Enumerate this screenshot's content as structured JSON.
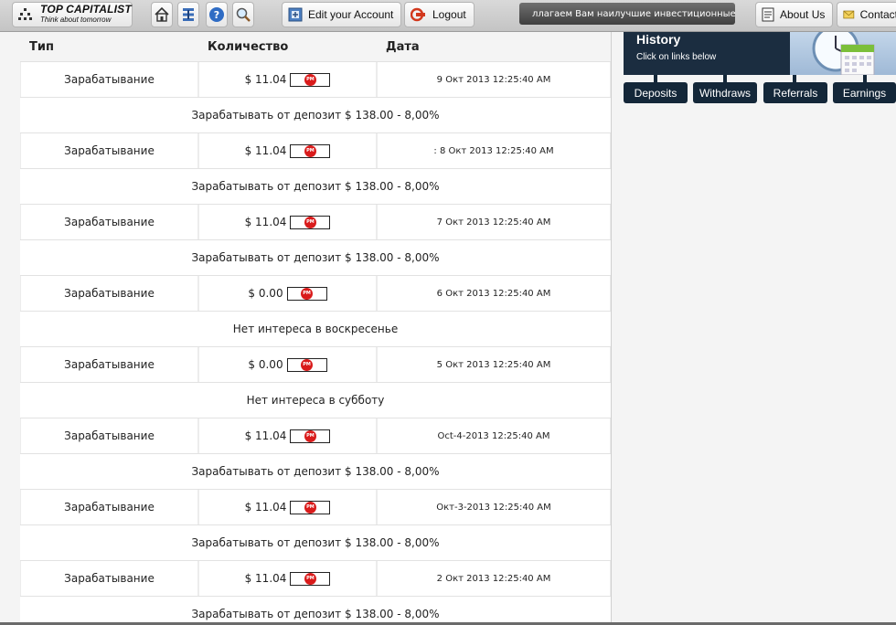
{
  "toolbar": {
    "logo_title": "TOP CAPITALIST",
    "logo_subtitle": "Think about tomorrow",
    "edit_account": "Edit your Account",
    "logout": "Logout",
    "ticker": "ллагаем Вам наилучшие инвестиционные реш",
    "about_us": "About Us",
    "contact": "Contact"
  },
  "sidebar": {
    "history_title": "History",
    "history_subtitle": "Click on links below",
    "buttons": [
      "Deposits",
      "Withdraws",
      "Referrals",
      "Earnings"
    ]
  },
  "table": {
    "headers": [
      "Тип",
      "Количество",
      "Дата"
    ],
    "pm_label": "PM",
    "rows": [
      {
        "type": "Зарабатывание",
        "amount": "$ 11.04",
        "date": "9 Окт 2013 12:25:40 AM",
        "note": "Зарабатывать от депозит $ 138.00 - 8,00%"
      },
      {
        "type": "Зарабатывание",
        "amount": "$ 11.04",
        "date": ": 8 Окт 2013 12:25:40 AM",
        "note": "Зарабатывать от депозит $ 138.00 - 8,00%"
      },
      {
        "type": "Зарабатывание",
        "amount": "$ 11.04",
        "date": "7 Окт 2013 12:25:40 AM",
        "note": "Зарабатывать от депозит $ 138.00 - 8,00%"
      },
      {
        "type": "Зарабатывание",
        "amount": "$ 0.00",
        "date": "6 Окт 2013 12:25:40 AM",
        "note": "Нет интереса в воскресенье"
      },
      {
        "type": "Зарабатывание",
        "amount": "$ 0.00",
        "date": "5 Окт 2013 12:25:40 AM",
        "note": "Нет интереса в субботу"
      },
      {
        "type": "Зарабатывание",
        "amount": "$ 11.04",
        "date": "Oct-4-2013 12:25:40 AM",
        "note": "Зарабатывать от депозит $ 138.00 - 8,00%"
      },
      {
        "type": "Зарабатывание",
        "amount": "$ 11.04",
        "date": "Окт-3-2013 12:25:40 AM",
        "note": "Зарабатывать от депозит $ 138.00 - 8,00%"
      },
      {
        "type": "Зарабатывание",
        "amount": "$ 11.04",
        "date": "2 Окт 2013 12:25:40 AM",
        "note": "Зарабатывать от депозит $ 138.00 - 8,00%"
      }
    ]
  }
}
